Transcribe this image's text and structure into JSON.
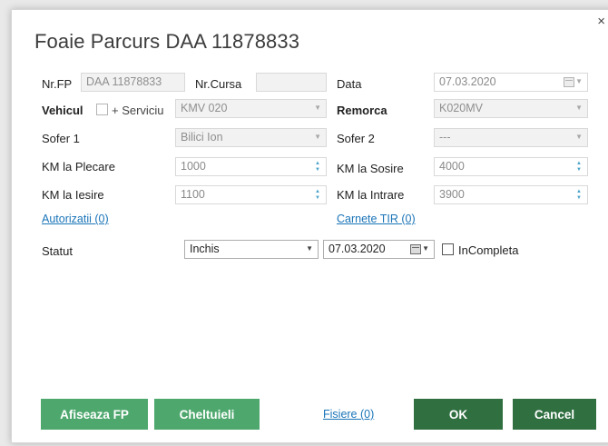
{
  "dialog": {
    "title": "Foaie Parcurs DAA 11878833",
    "close_label": "×"
  },
  "form": {
    "nrfp_label": "Nr.FP",
    "nrfp_value": "DAA 11878833",
    "nrcursa_label": "Nr.Cursa",
    "nrcursa_value": "",
    "data_label": "Data",
    "data_value": "07.03.2020",
    "vehicul_label": "Vehicul",
    "serviciu_label": "+ Serviciu",
    "vehicul_value": "KMV 020",
    "remorca_label": "Remorca",
    "remorca_value": "K020MV",
    "sofer1_label": "Sofer 1",
    "sofer1_value": "Bilici Ion",
    "sofer2_label": "Sofer 2",
    "sofer2_value": "---",
    "km_plecare_label": "KM la Plecare",
    "km_plecare_value": "1000",
    "km_sosire_label": "KM la Sosire",
    "km_sosire_value": "4000",
    "km_iesire_label": "KM la Iesire",
    "km_iesire_value": "1100",
    "km_intrare_label": "KM la Intrare",
    "km_intrare_value": "3900",
    "autorizatii_link": "Autorizatii (0)",
    "carnete_link": "Carnete TIR (0)",
    "statut_label": "Statut",
    "statut_value": "Inchis",
    "statut_date": "07.03.2020",
    "incompleta_label": "InCompleta"
  },
  "footer": {
    "afiseaza_label": "Afiseaza FP",
    "cheltuieli_label": "Cheltuieli",
    "fisiere_link": "Fisiere (0)",
    "ok_label": "OK",
    "cancel_label": "Cancel"
  },
  "icons": {
    "combo_arrow": "chevron-down-icon",
    "spin": "spin-arrows-icon",
    "calendar": "calendar-icon"
  },
  "colors": {
    "green_button": "#4ea86e",
    "dark_green_button": "#2f6f40",
    "link": "#1a74b8"
  }
}
